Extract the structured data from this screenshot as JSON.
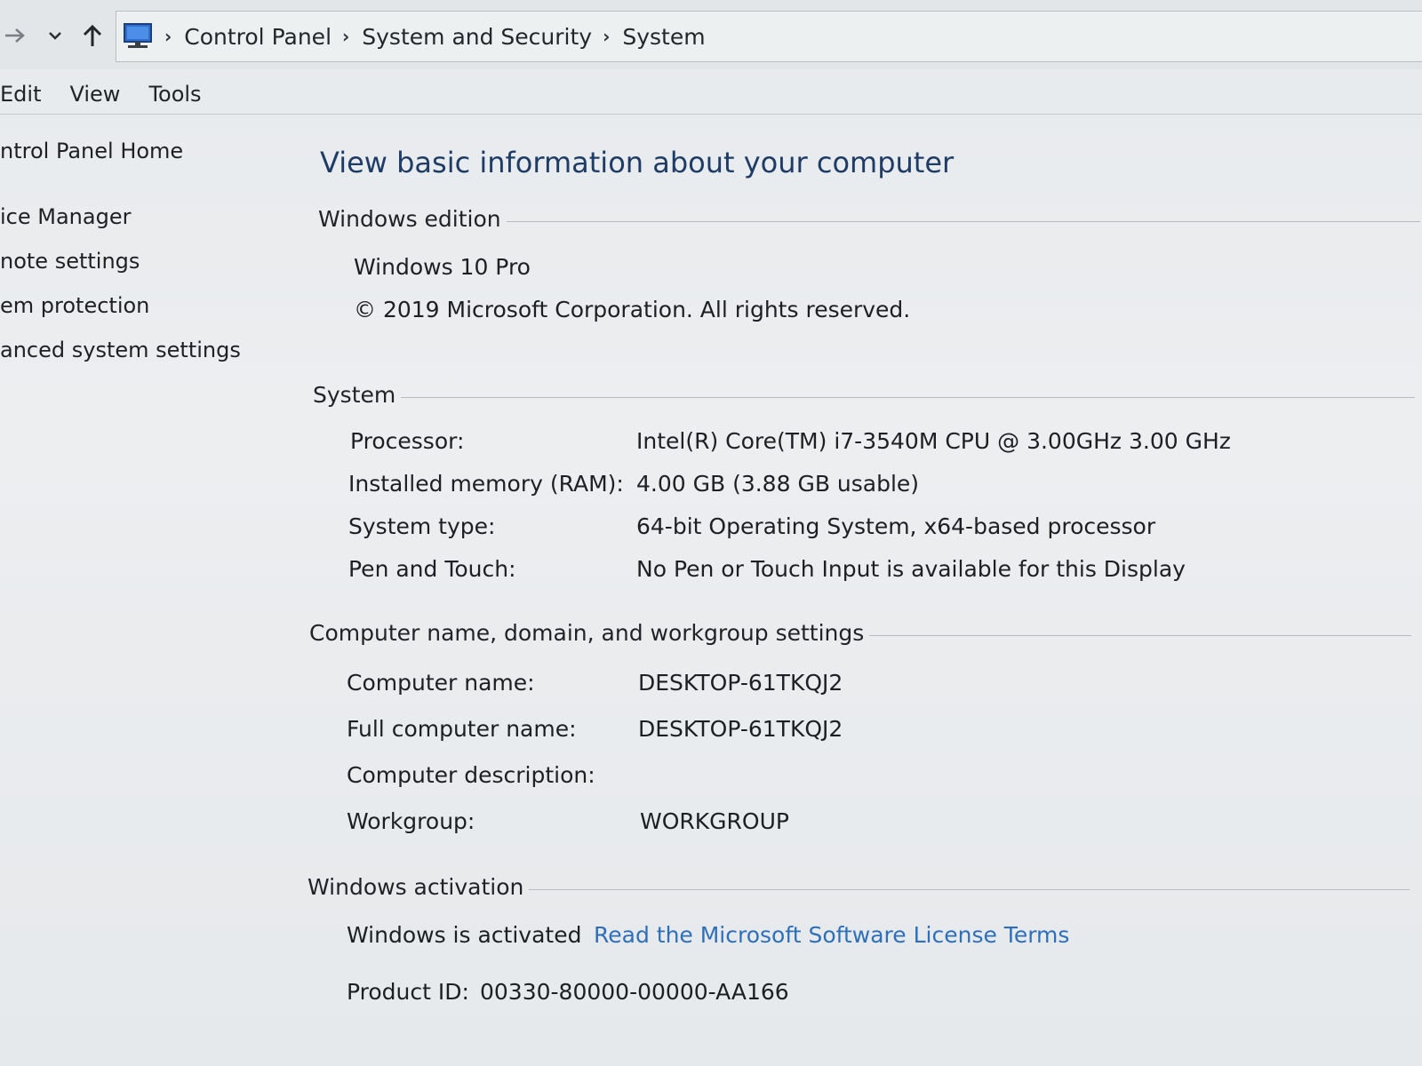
{
  "address_bar": {
    "forward_icon": "arrow-right-icon",
    "recent_icon": "chevron-down-icon",
    "up_icon": "arrow-up-icon",
    "location_icon": "computer-icon",
    "breadcrumbs": [
      "Control Panel",
      "System and Security",
      "System"
    ]
  },
  "menu": {
    "items": [
      "Edit",
      "View",
      "Tools"
    ]
  },
  "left_pane": {
    "home": "ntrol Panel Home",
    "links": [
      "ice Manager",
      "note settings",
      "em protection",
      "anced system settings"
    ]
  },
  "main": {
    "title": "View basic information about your computer",
    "windows_edition": {
      "header": "Windows edition",
      "edition": "Windows 10 Pro",
      "copyright": "© 2019 Microsoft Corporation. All rights reserved."
    },
    "system": {
      "header": "System",
      "rows": [
        {
          "label": "Processor:",
          "value": "Intel(R) Core(TM) i7-3540M CPU @ 3.00GHz   3.00 GHz"
        },
        {
          "label": "Installed memory (RAM):",
          "value": "4.00 GB (3.88 GB usable)"
        },
        {
          "label": "System type:",
          "value": "64-bit Operating System, x64-based processor"
        },
        {
          "label": "Pen and Touch:",
          "value": "No Pen or Touch Input is available for this Display"
        }
      ]
    },
    "computer_name": {
      "header": "Computer name, domain, and workgroup settings",
      "rows": [
        {
          "label": "Computer name:",
          "value": "DESKTOP-61TKQJ2"
        },
        {
          "label": "Full computer name:",
          "value": "DESKTOP-61TKQJ2"
        },
        {
          "label": "Computer description:",
          "value": ""
        },
        {
          "label": "Workgroup:",
          "value": "WORKGROUP"
        }
      ]
    },
    "activation": {
      "header": "Windows activation",
      "status": "Windows is activated",
      "license_link": "Read the Microsoft Software License Terms",
      "product_id_label": "Product ID:",
      "product_id": "00330-80000-00000-AA166"
    }
  },
  "colors": {
    "link": "#2f6fb8",
    "title": "#1f3c66",
    "background": "#e9ecee"
  }
}
